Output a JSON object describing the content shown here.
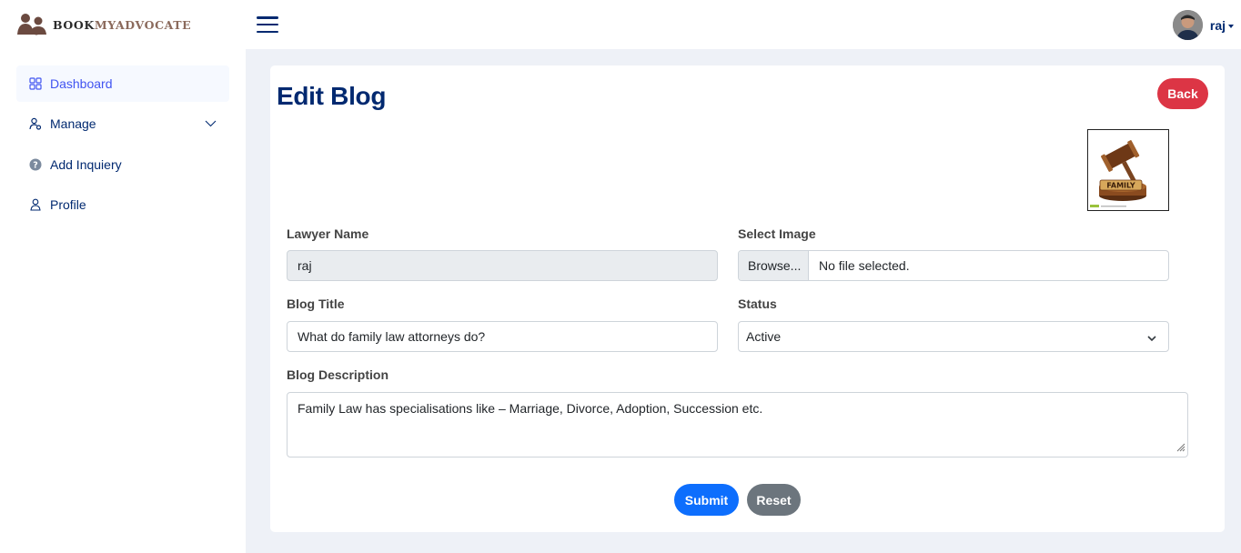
{
  "brand": {
    "part1": "BOOK",
    "part2": "MYADVOCATE"
  },
  "header": {
    "user_name": "raj"
  },
  "sidebar": {
    "items": [
      {
        "label": "Dashboard",
        "icon": "grid-icon",
        "active": true
      },
      {
        "label": "Manage",
        "icon": "user-gear-icon",
        "has_submenu": true
      },
      {
        "label": "Add Inquiery",
        "icon": "question-circle-icon"
      },
      {
        "label": "Profile",
        "icon": "person-icon"
      }
    ]
  },
  "page": {
    "title": "Edit Blog",
    "back_label": "Back"
  },
  "thumbnail": {
    "caption": "FAMILY"
  },
  "form": {
    "lawyer_name": {
      "label": "Lawyer Name",
      "value": "raj"
    },
    "select_image": {
      "label": "Select Image",
      "button": "Browse...",
      "status": "No file selected."
    },
    "blog_title": {
      "label": "Blog Title",
      "value": "What do family law attorneys do?"
    },
    "status": {
      "label": "Status",
      "value": "Active"
    },
    "blog_description": {
      "label": "Blog Description",
      "value": "Family Law has specialisations like – Marriage, Divorce, Adoption, Succession etc."
    },
    "submit_label": "Submit",
    "reset_label": "Reset"
  },
  "colors": {
    "primary": "#4154f1",
    "navy": "#012970",
    "danger": "#dc3545",
    "blue": "#0d6efd",
    "gray": "#6c757d"
  }
}
